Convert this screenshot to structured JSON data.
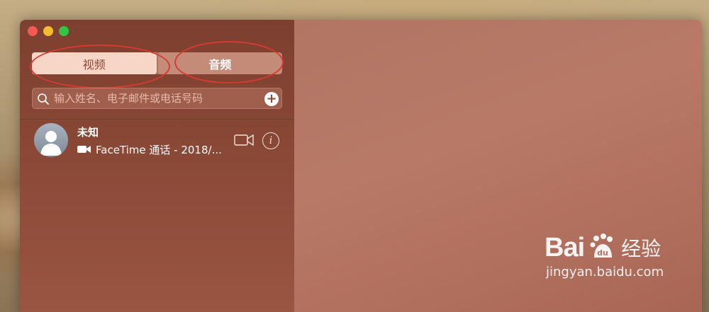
{
  "segments": {
    "video": "视频",
    "audio": "音频"
  },
  "search": {
    "placeholder": "输入姓名、电子邮件或电话号码"
  },
  "recents": [
    {
      "name": "未知",
      "detail": "FaceTime 通话 - 2018/..."
    }
  ],
  "watermark": {
    "brand_left": "Bai",
    "brand_right": "经验",
    "url": "jingyan.baidu.com"
  },
  "colors": {
    "sidebar": "#8a4836",
    "content": "#b27563",
    "annotation": "#d63a33"
  },
  "icons": [
    "search-icon",
    "add-icon",
    "video-call-icon",
    "info-icon",
    "avatar-icon",
    "paw-icon"
  ]
}
